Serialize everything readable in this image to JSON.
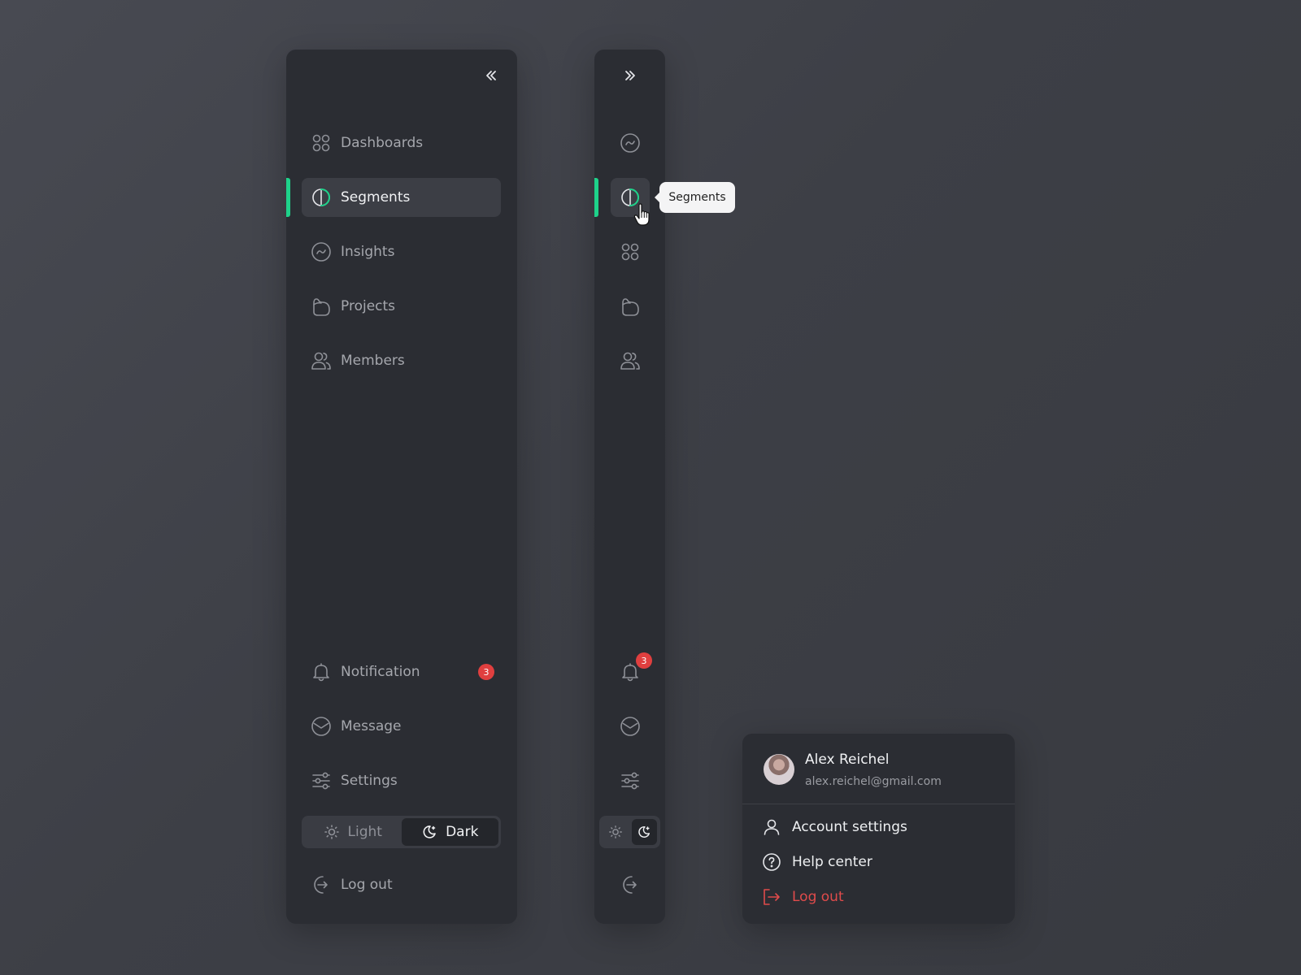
{
  "colors": {
    "accent": "#1ed28a",
    "danger": "#e04b4b",
    "panel": "#2b2d33",
    "badge": "#e03f3f"
  },
  "expanded_sidebar": {
    "collapse_icon": "chevrons-left-icon",
    "nav_items": [
      {
        "label": "Dashboards",
        "icon": "grid-icon",
        "active": false
      },
      {
        "label": "Segments",
        "icon": "half-circle-icon",
        "active": true
      },
      {
        "label": "Insights",
        "icon": "trend-circle-icon",
        "active": false
      },
      {
        "label": "Projects",
        "icon": "folder-icon",
        "active": false
      },
      {
        "label": "Members",
        "icon": "users-icon",
        "active": false
      }
    ],
    "bottom_items": [
      {
        "label": "Notification",
        "icon": "bell-icon",
        "badge": "3"
      },
      {
        "label": "Message",
        "icon": "mail-icon"
      },
      {
        "label": "Settings",
        "icon": "sliders-icon"
      }
    ],
    "theme": {
      "light_label": "Light",
      "dark_label": "Dark",
      "selected": "Dark"
    },
    "logout_label": "Log out"
  },
  "collapsed_sidebar": {
    "expand_icon": "chevrons-right-icon",
    "tooltip": "Segments",
    "notification_badge": "3"
  },
  "profile_menu": {
    "name": "Alex Reichel",
    "email": "alex.reichel@gmail.com",
    "items": [
      {
        "label": "Account settings",
        "icon": "user-icon"
      },
      {
        "label": "Help center",
        "icon": "help-circle-icon"
      },
      {
        "label": "Log out",
        "icon": "logout-icon",
        "danger": true
      }
    ]
  }
}
